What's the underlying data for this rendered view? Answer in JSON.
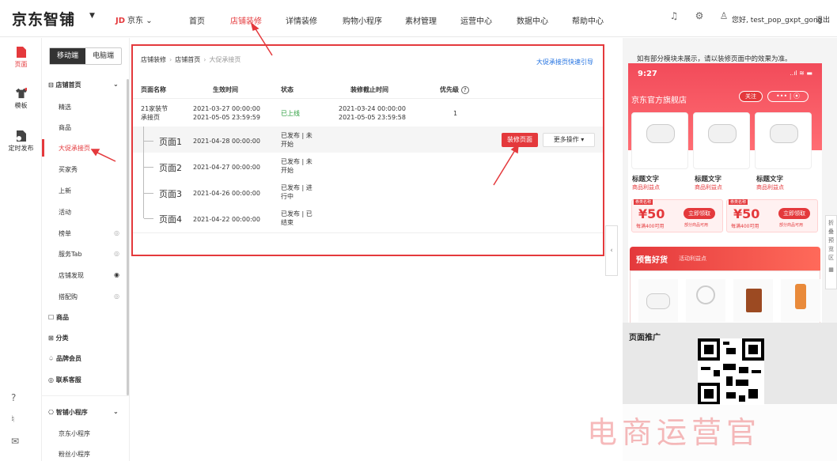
{
  "topbar": {
    "logo": "京东智铺",
    "jd_brand": "JD",
    "jd_text": "京东",
    "nav": [
      "首页",
      "店铺装修",
      "详情装修",
      "购物小程序",
      "素材管理",
      "运营中心",
      "数据中心",
      "帮助中心"
    ],
    "active_nav": "店铺装修",
    "greeting": "您好, test_pop_gxpt_gong",
    "logout": "退出"
  },
  "rail": {
    "items": [
      {
        "label": "页面",
        "active": true
      },
      {
        "label": "模板",
        "active": false
      },
      {
        "label": "定时发布",
        "active": false
      }
    ]
  },
  "panel": {
    "mode_mobile": "移动端",
    "mode_pc": "电脑端",
    "group_home": "店铺首页",
    "items": [
      "精选",
      "商品",
      "大促承接页",
      "买家秀",
      "上新",
      "活动",
      "榜单",
      "服务Tab",
      "店铺发现",
      "搭配购"
    ],
    "groups": [
      "商品",
      "分类",
      "品牌会员",
      "联系客服"
    ],
    "group_mini": "智铺小程序",
    "mini_items": [
      "京东小程序",
      "粉丝小程序"
    ]
  },
  "main": {
    "crumb": [
      "店铺装修",
      "店铺首页",
      "大促承接页"
    ],
    "guide_link": "大促承接页快速引导",
    "headers": [
      "页面名称",
      "生效时间",
      "状态",
      "装修截止时间",
      "优先级"
    ],
    "main_row": {
      "name_line1": "21家装节",
      "name_line2": "承接页",
      "time_line1": "2021-03-27 00:00:00",
      "time_line2": "2021-05-05 23:59:59",
      "status": "已上线",
      "deadline_line1": "2021-03-24 00:00:00",
      "deadline_line2": "2021-05-05 23:59:58",
      "priority": "1"
    },
    "sub_rows": [
      {
        "name": "页面1",
        "time": "2021-04-28 00:00:00",
        "status_line1": "已发布 | 未",
        "status_line2": "开始"
      },
      {
        "name": "页面2",
        "time": "2021-04-27 00:00:00",
        "status_line1": "已发布 | 未",
        "status_line2": "开始"
      },
      {
        "name": "页面3",
        "time": "2021-04-26 00:00:00",
        "status_line1": "已发布 | 进",
        "status_line2": "行中"
      },
      {
        "name": "页面4",
        "time": "2021-04-22 00:00:00",
        "status_line1": "已发布 | 已",
        "status_line2": "结束"
      }
    ],
    "decorate_button": "装修页面",
    "more_button": "更多操作 ▾"
  },
  "preview": {
    "tip": "如有部分模块未展示，请以装修页面中的效果为准。",
    "time": "9:27",
    "status_icons": "..ıl ≋ ▬",
    "store_name": "京东官方旗舰店",
    "follow": "关注",
    "more": "••• | ⦿",
    "products": [
      {
        "title": "标题文字",
        "sub": "商品利益点"
      },
      {
        "title": "标题文字",
        "sub": "商品利益点"
      },
      {
        "title": "标题文字",
        "sub": "商品利益点"
      }
    ],
    "coupons": [
      {
        "tag": "券类名称",
        "amount": "¥50",
        "cond": "每满400可用",
        "btn": "立即领取",
        "note": "部分商品可用"
      },
      {
        "tag": "券类名称",
        "amount": "¥50",
        "cond": "每满400可用",
        "btn": "立即领取",
        "note": "部分商品可用"
      }
    ],
    "presale_title": "预售好货",
    "presale_sub": "活动利益点",
    "promo_title": "页面推广",
    "side_tab": "折叠预览区"
  },
  "watermark": "电商运营官",
  "colors": {
    "accent": "#e4393c",
    "link": "#1e6fe0",
    "success": "#2a9d3c"
  }
}
